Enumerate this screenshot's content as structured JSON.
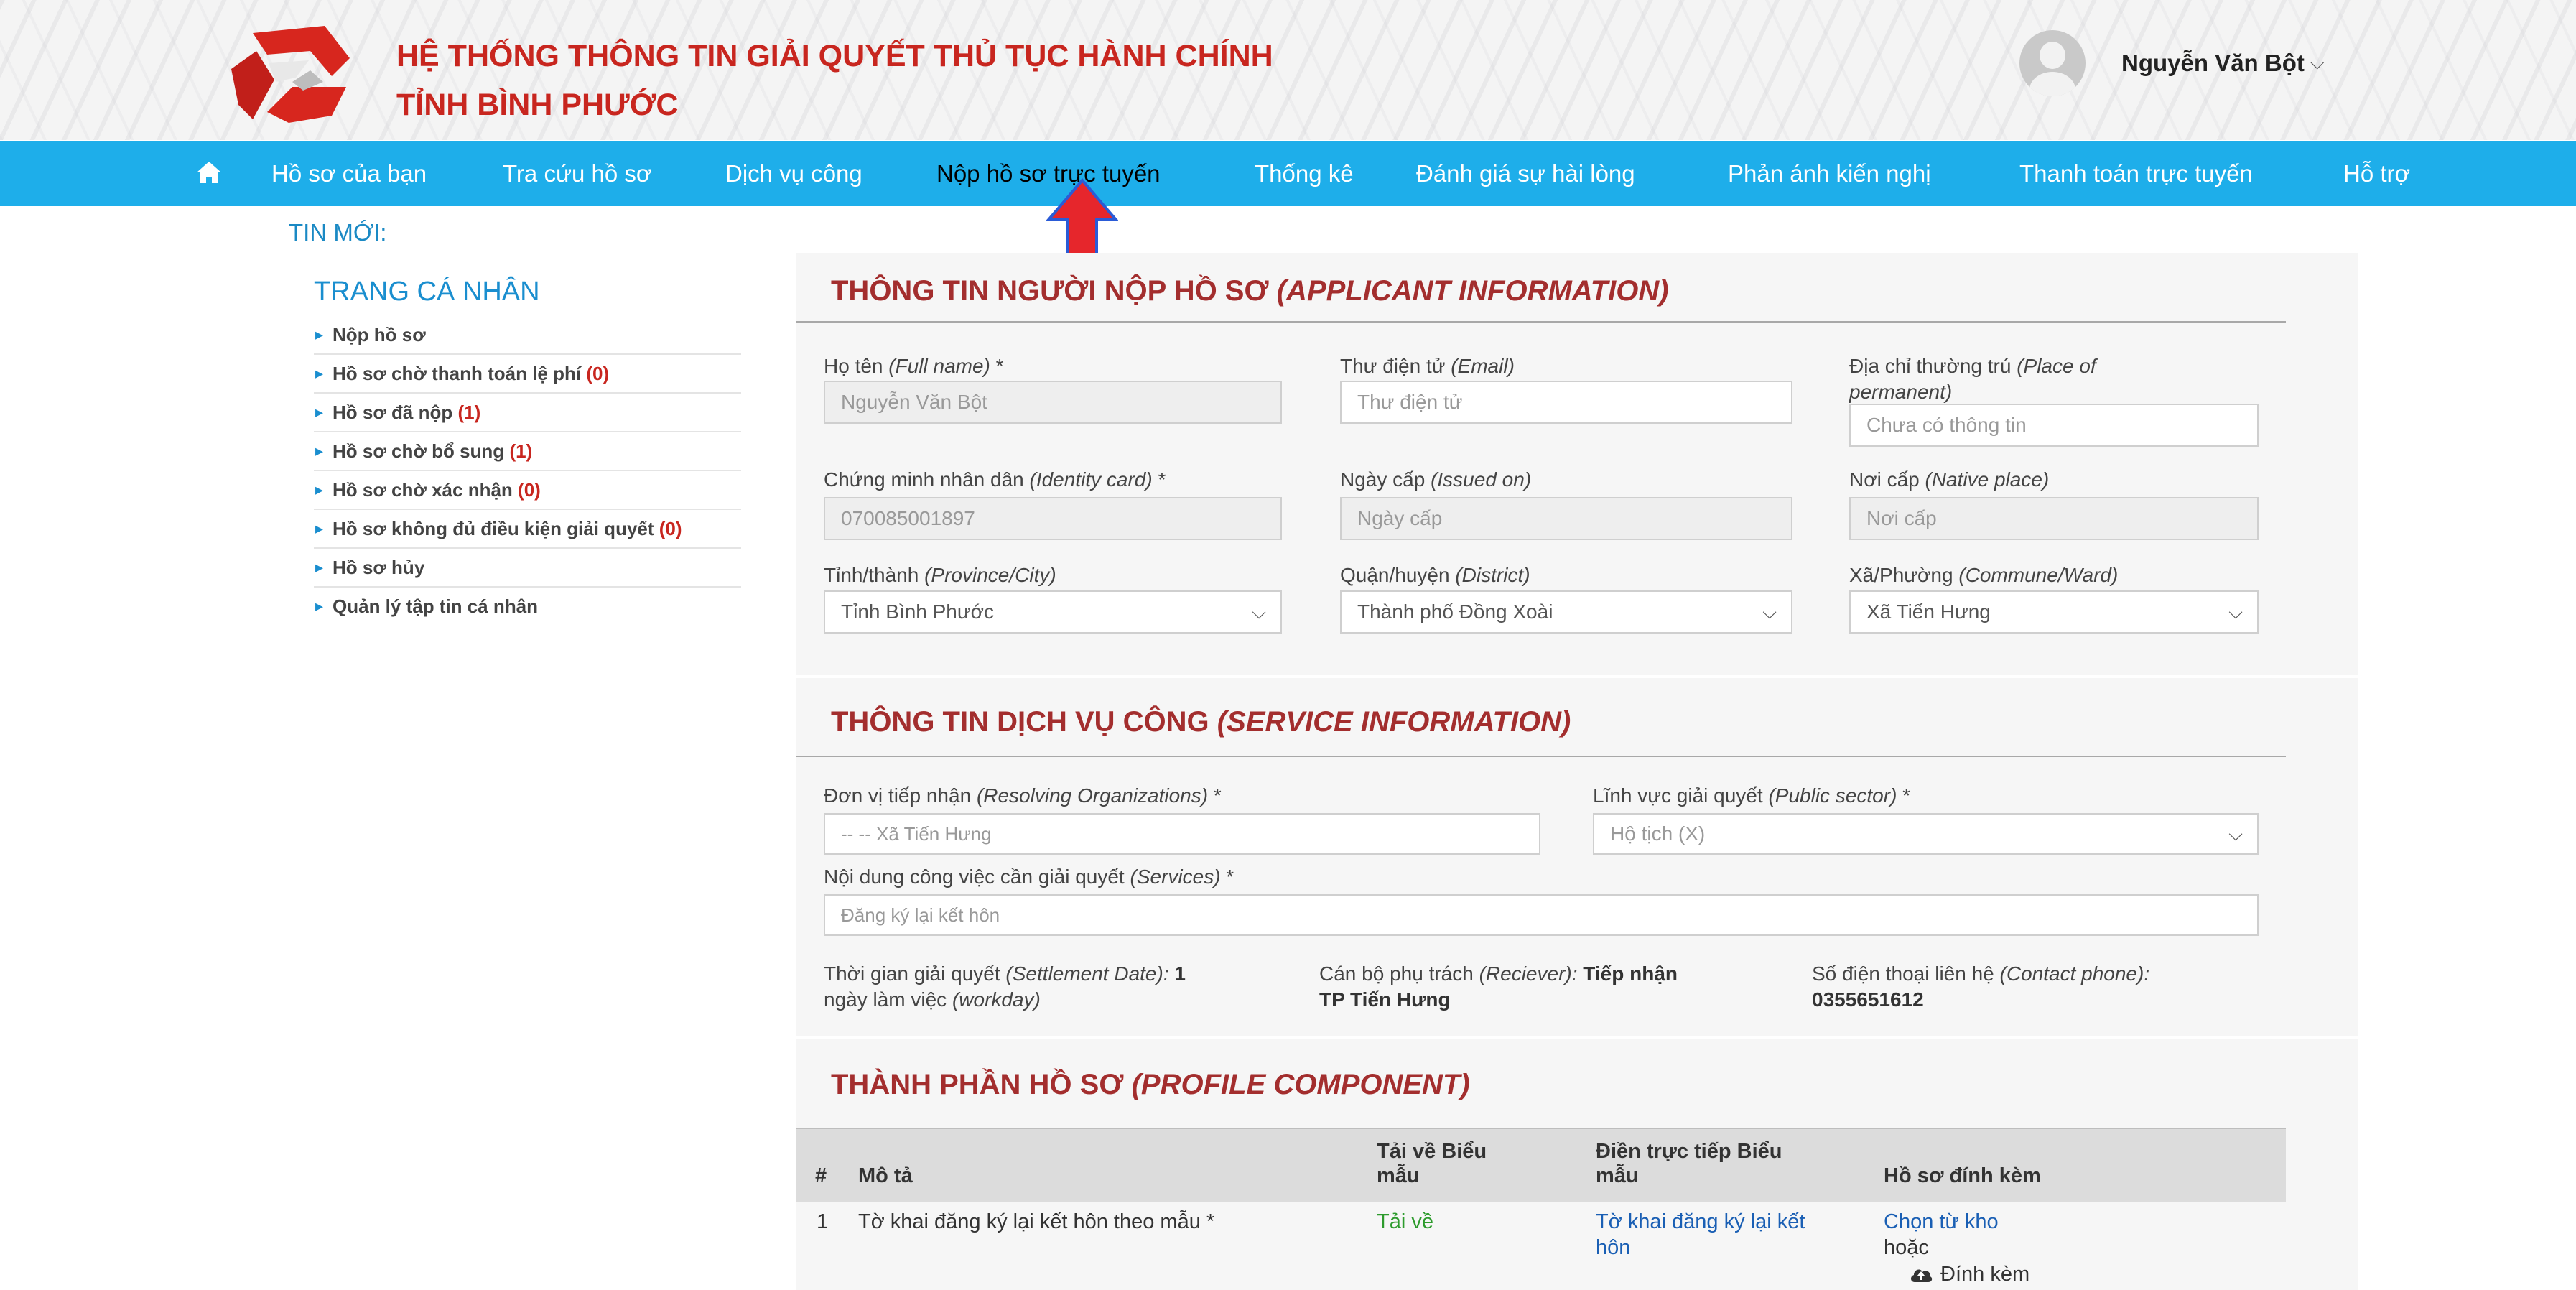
{
  "header": {
    "title_line1": "HỆ THỐNG THÔNG TIN GIẢI QUYẾT THỦ TỤC HÀNH CHÍNH",
    "title_line2": "TỈNH BÌNH PHƯỚC",
    "user_name": "Nguyễn Văn Bột",
    "colors": {
      "title": "#c8261f",
      "nav": "#1eaeea"
    }
  },
  "nav": {
    "items": [
      "Hồ sơ của bạn",
      "Tra cứu hồ sơ",
      "Dịch vụ công",
      "Nộp hồ sơ trực tuyến",
      "Thống kê",
      "Đánh giá sự hài lòng",
      "Phản ánh kiến nghị",
      "Thanh toán trực tuyến",
      "Hỗ trợ"
    ],
    "active": "Nộp hồ sơ trực tuyến"
  },
  "news_label": "TIN MỚI:",
  "sidebar": {
    "title": "TRANG CÁ NHÂN",
    "items": [
      {
        "label": "Nộp hồ sơ",
        "count": ""
      },
      {
        "label": "Hồ sơ chờ thanh toán lệ phí",
        "count": "(0)"
      },
      {
        "label": "Hồ sơ đã nộp",
        "count": "(1)"
      },
      {
        "label": "Hồ sơ chờ bổ sung",
        "count": "(1)"
      },
      {
        "label": "Hồ sơ chờ xác nhận",
        "count": "(0)"
      },
      {
        "label": "Hồ sơ không đủ điều kiện giải quyết",
        "count": "(0)"
      },
      {
        "label": "Hồ sơ hủy",
        "count": ""
      },
      {
        "label": "Quản lý tập tin cá nhân",
        "count": ""
      }
    ]
  },
  "applicant": {
    "title": "THÔNG TIN NGƯỜI NỘP HỒ SƠ",
    "title_en": "(APPLICANT INFORMATION)",
    "fullname": {
      "label": "Họ tên",
      "label_en": "(Full name)",
      "req": " *",
      "value": "Nguyễn Văn Bột"
    },
    "email": {
      "label": "Thư điện tử",
      "label_en": "(Email)",
      "placeholder": "Thư điện tử"
    },
    "address": {
      "label": "Địa chỉ thường trú",
      "label_en_1": "(Place of",
      "label_en_2": "permanent)",
      "placeholder": "Chưa có thông tin"
    },
    "idcard": {
      "label": "Chứng minh nhân dân",
      "label_en": "(Identity card)",
      "req": " *",
      "value": "070085001897"
    },
    "issued": {
      "label": "Ngày cấp",
      "label_en": "(Issued on)",
      "placeholder": "Ngày cấp"
    },
    "native": {
      "label": "Nơi cấp",
      "label_en": "(Native place)",
      "placeholder": "Nơi cấp"
    },
    "province": {
      "label": "Tỉnh/thành",
      "label_en": "(Province/City)",
      "value": "Tỉnh Bình Phước"
    },
    "district": {
      "label": "Quận/huyện",
      "label_en": "(District)",
      "value": "Thành phố Đồng Xoài"
    },
    "ward": {
      "label": "Xã/Phường",
      "label_en": "(Commune/Ward)",
      "value": "Xã Tiến Hưng"
    }
  },
  "service": {
    "title": "THÔNG TIN DỊCH VỤ CÔNG",
    "title_en": "(SERVICE INFORMATION)",
    "org": {
      "label": "Đơn vị tiếp nhận",
      "label_en": "(Resolving Organizations)",
      "req": " *",
      "value": "-- -- Xã Tiến Hưng"
    },
    "sector": {
      "label": "Lĩnh vực giải quyết",
      "label_en": "(Public sector)",
      "req": " *",
      "value": "Hộ tịch (X)"
    },
    "services": {
      "label": "Nội dung công việc cần giải quyết",
      "label_en": "(Services)",
      "req": " *",
      "value": "Đăng ký lại kết hôn"
    },
    "settle": {
      "label": "Thời gian giải quyết",
      "label_en": "(Settlement Date):",
      "value": "1",
      "unit": "ngày làm việc",
      "unit_en": "(workday)"
    },
    "receiver": {
      "label": "Cán bộ phụ trách",
      "label_en": "(Reciever):",
      "value1": "Tiếp nhận",
      "value2": "TP Tiến Hưng"
    },
    "phone": {
      "label": "Số điện thoại liên hệ",
      "label_en": "(Contact phone):",
      "value": "0355651612"
    }
  },
  "profile": {
    "title": "THÀNH PHẦN HỒ SƠ",
    "title_en": "(PROFILE COMPONENT)",
    "headers": {
      "num": "#",
      "desc": "Mô tả",
      "download_1": "Tải về Biểu",
      "download_2": "mẫu",
      "fill_1": "Điền trực tiếp Biểu",
      "fill_2": "mẫu",
      "attach": "Hồ sơ đính kèm"
    },
    "rows": [
      {
        "num": "1",
        "desc": "Tờ khai đăng ký lại kết hôn theo mẫu *",
        "download": "Tải về",
        "fill_1": "Tờ khai đăng ký lại kết",
        "fill_2": "hôn",
        "choose": "Chọn từ kho",
        "or": "hoặc",
        "attach": "Đính kèm"
      }
    ]
  }
}
